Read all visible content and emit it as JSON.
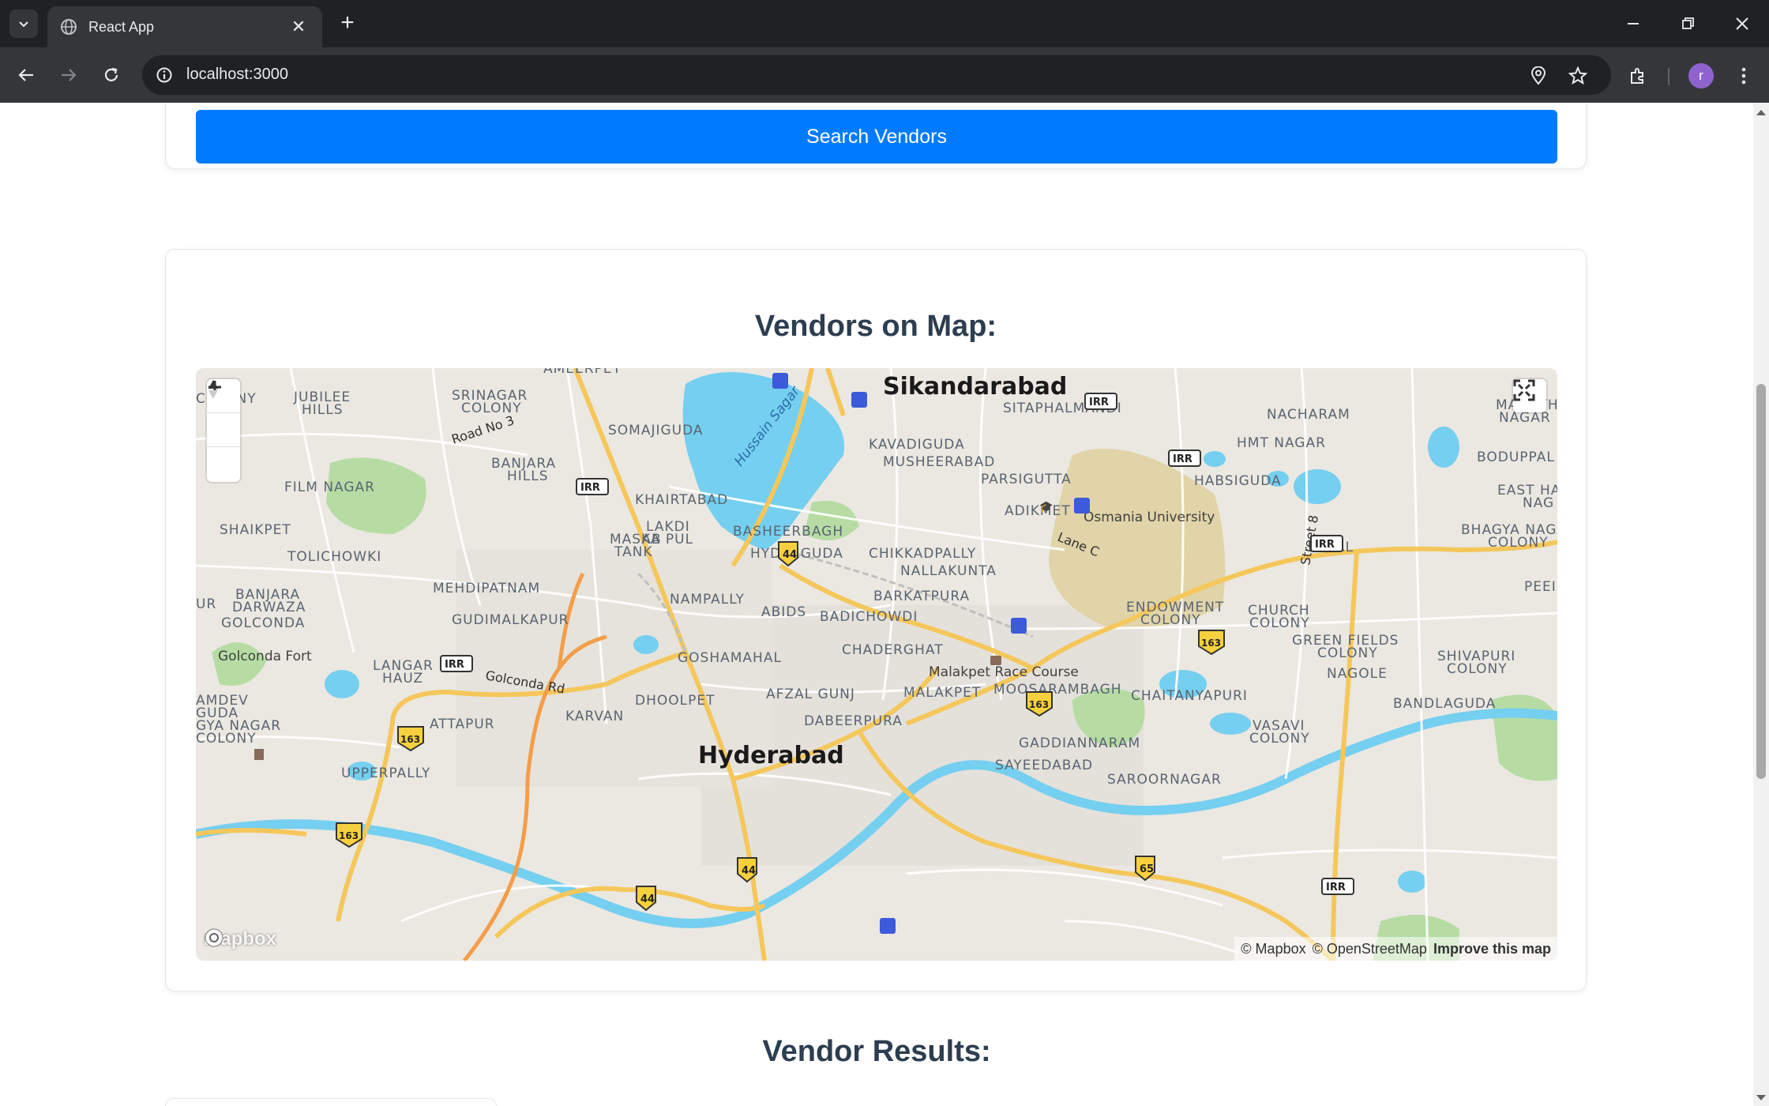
{
  "browser": {
    "tab_title": "React App",
    "url": "localhost:3000",
    "profile_initial": "r"
  },
  "page": {
    "search_button_label": "Search Vendors",
    "map_section_title": "Vendors on Map:",
    "results_section_title": "Vendor Results:"
  },
  "map": {
    "labels": {
      "sikandarabad": "Sikandarabad",
      "hyderabad": "Hyderabad",
      "ameerpet": "AMEERPET",
      "colony_w": "COLONY",
      "jubilee_hills": "JUBILEE",
      "jubilee_hills2": "HILLS",
      "srinagar": "SRINAGAR",
      "srinagar2": "COLONY",
      "somajiguda": "SOMAJIGUDA",
      "banjara_hills": "BANJARA",
      "banjara_hills2": "HILLS",
      "film_nagar": "FILM NAGAR",
      "shaikpet": "SHAIKPET",
      "tolichowki": "TOLICHOWKI",
      "banjara_darwaza": "BANJARA",
      "banjara_darwaza2": "DARWAZA",
      "golconda": "GOLCONDA",
      "golconda_fort": "Golconda Fort",
      "mehdipatnam": "MEHDIPATNAM",
      "gudimalkapur": "GUDIMALKAPUR",
      "langar_hauz": "LANGAR",
      "langar_hauz2": "HAUZ",
      "attapur": "ATTAPUR",
      "upperpally": "UPPERPALLY",
      "khairtabad": "KHAIRTABAD",
      "lakdi_ka_pul": "LAKDI",
      "lakdi_ka_pul2": "KA PUL",
      "masab_tank": "MASAB",
      "masab_tank2": "TANK",
      "basheerbagh": "BASHEERBAGH",
      "hyderguda": "HYDERGUDA",
      "nampally": "NAMPALLY",
      "abids": "ABIDS",
      "goshamahal": "GOSHAMAHAL",
      "dhoolpet": "DHOOLPET",
      "karvan": "KARVAN",
      "afzal_gunj": "AFZAL GUNJ",
      "kavadiguda": "KAVADIGUDA",
      "musheerabad": "MUSHEERABAD",
      "parsigutta": "PARSIGUTTA",
      "adikmet": "ADIKMET",
      "chikkadpally": "CHIKKADPALLY",
      "nallakunta": "NALLAKUNTA",
      "barkatpura": "BARKATPURA",
      "badichowdi": "BADICHOWDI",
      "chaderghat": "CHADERGHAT",
      "malakpet": "MALAKPET",
      "dabeerpura": "DABEERPURA",
      "sitaphalmandi": "SITAPHALMANDI",
      "osmania": "Osmania University",
      "malakpet_race": "Malakpet Race Course",
      "moosarambagh": "MOOSARAMBAGH",
      "endowment": "ENDOWMENT",
      "endowment2": "COLONY",
      "church_colony": "CHURCH",
      "church_colony2": "COLONY",
      "nacharam": "NACHARAM",
      "hmt_nagar": "HMT NAGAR",
      "habsiguda": "HABSIGUDA",
      "maruthi": "MARUTHI",
      "maruthi2": "NAGAR",
      "boduppal": "BODUPPAL",
      "east_ha": "EAST HA",
      "east_ha2": "NAG",
      "bhagya": "BHAGYA NAGA",
      "bhagya2": "COLONY",
      "uppal": "UPPAL",
      "peel": "PEEI",
      "green_fields": "GREEN FIELDS",
      "green_fields2": "COLONY",
      "shivapuri": "SHIVAPURI",
      "shivapuri2": "COLONY",
      "nagole": "NAGOLE",
      "chaitanyapuri": "CHAITANYAPURI",
      "bandlaguda": "BANDLAGUDA",
      "vasavi": "VASAVI",
      "vasavi2": "COLONY",
      "gaddiannaram": "GADDIANNARAM",
      "sayeedabad": "SAYEEDABAD",
      "saroornagar": "SAROORNAGAR",
      "hussain_sagar": "Hussain Sagar",
      "road_no_3": "Road No 3",
      "golconda_rd": "Golconda Rd",
      "lane_c": "Lane C",
      "street_8": "Street 8",
      "amdev": "AMDEV",
      "amdev2": "GUDA",
      "gya_nagar": "GYA NAGAR",
      "gya_nagar2": "COLONY",
      "ur": "UR"
    },
    "shields": {
      "irr": "IRR",
      "nh44": "44",
      "nh163": "163",
      "nh65": "65"
    },
    "logo": "mapbox",
    "attribution_mapbox": "© Mapbox",
    "attribution_osm": "© OpenStreetMap",
    "attribution_improve": "Improve this map"
  },
  "colors": {
    "button_primary": "#007bff",
    "heading": "#2c3e50",
    "water": "#75cff0",
    "park": "#b6dca4",
    "road_major": "#f5c75b",
    "road_orange": "#f49d4a"
  }
}
